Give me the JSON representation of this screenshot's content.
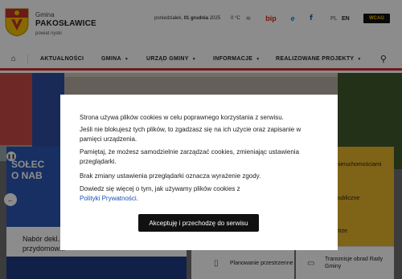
{
  "header": {
    "brand_small": "Gmina",
    "brand_big": "PAKOSŁAWICE",
    "brand_sub": "powiat nyski",
    "date_weekday": "poniedziałek,",
    "date_day": "01 grudnia",
    "date_year": "2025",
    "temperature": "0 °C",
    "weather_icon": "≈",
    "bip_label": "bip",
    "epuap_label": "e",
    "facebook_label": "f",
    "lang_pl": "PL",
    "lang_en": "EN",
    "wcag_label": "WCAG",
    "colors": {
      "bip": "#d9241c",
      "facebook": "#1d5fb8",
      "wcag_bg": "#111111",
      "wcag_fg": "#f3c000"
    }
  },
  "nav": {
    "home_icon": "home-icon",
    "items": [
      {
        "label": "AKTUALNOŚCI",
        "dropdown": false
      },
      {
        "label": "GMINA",
        "dropdown": true
      },
      {
        "label": "URZĄD GMINY",
        "dropdown": true
      },
      {
        "label": "INFORMACJE",
        "dropdown": true
      },
      {
        "label": "REALIZOWANE PROJEKTY",
        "dropdown": true
      }
    ],
    "search_icon": "search-icon",
    "accent_color": "#c9302c"
  },
  "background": {
    "slide_title_line1": "SOŁEC",
    "slide_title_line2": "O NAB",
    "slide_caption": "Nabór dekl... przydomow...",
    "tiles": [
      {
        "label": "Gospodarka nieruchomościami"
      },
      {
        "label": "Zamówienia publiczne"
      },
      {
        "label": "Czyste Powietrze"
      },
      {
        "label": "Planowanie przestrzenne"
      },
      {
        "label": "Transmisje obrad Rady Gminy"
      }
    ]
  },
  "cookie": {
    "p1": "Strona używa plików cookies w celu poprawnego korzystania z serwisu.",
    "p2": "Jeśli nie blokujesz tych plików, to zgadzasz się na ich użycie oraz zapisanie w pamięci urządzenia.",
    "p3": "Pamiętaj, że możesz samodzielnie zarządzać cookies, zmieniając ustawienia przeglądarki.",
    "p4": "Brak zmiany ustawienia przeglądarki oznacza wyrażenie zgody.",
    "p5_text": "Dowiedz się więcej o tym, jak używamy plików cookies z",
    "p5_link": "Polityki Prywatności",
    "p5_end": ".",
    "accept_label": "Akceptuję i przechodzę do serwisu"
  }
}
